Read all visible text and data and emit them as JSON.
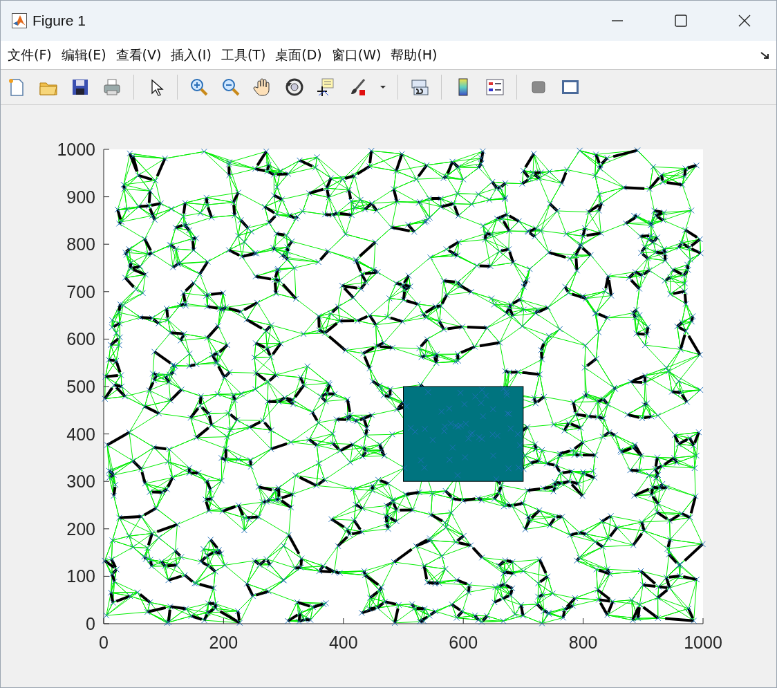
{
  "window": {
    "title": "Figure 1"
  },
  "menu": [
    "文件(F)",
    "编辑(E)",
    "查看(V)",
    "插入(I)",
    "工具(T)",
    "桌面(D)",
    "窗口(W)",
    "帮助(H)"
  ],
  "axes": {
    "xticks": [
      "0",
      "200",
      "400",
      "600",
      "800",
      "1000"
    ],
    "yticks": [
      "1000",
      "900",
      "800",
      "700",
      "600",
      "500",
      "400",
      "300",
      "200",
      "100",
      "0"
    ]
  }
}
